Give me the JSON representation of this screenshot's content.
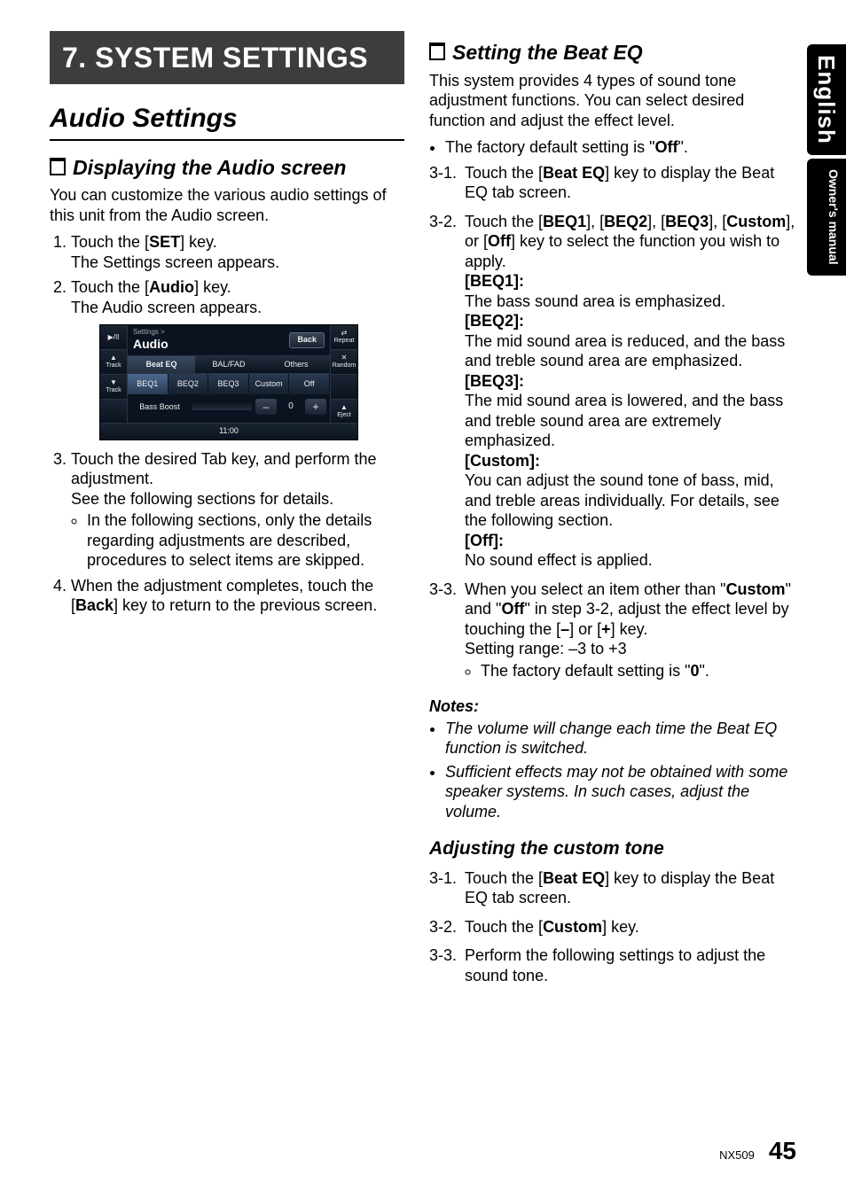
{
  "chapter": "7.  SYSTEM SETTINGS",
  "h2": "Audio Settings",
  "h3a": "Displaying the Audio screen",
  "p1": "You can customize the various audio settings of this unit from the Audio screen.",
  "left": {
    "s1a": "Touch the [",
    "s1b": "SET",
    "s1c": "] key.",
    "s1d": "The Settings screen appears.",
    "s2a": "Touch the [",
    "s2b": "Audio",
    "s2c": "] key.",
    "s2d": "The Audio screen appears.",
    "s3a": "Touch the desired Tab key, and perform the adjustment.",
    "s3b": "See the following sections for details.",
    "s3bullet": "In the following sections, only the details regarding adjustments are described, procedures to select items are skipped.",
    "s4a": "When the adjustment completes, touch the [",
    "s4b": "Back",
    "s4c": "] key to return to the previous screen."
  },
  "screenshot": {
    "crumb": "Settings >",
    "title": "Audio",
    "back": "Back",
    "tabs": [
      "Beat EQ",
      "BAL/FAD",
      "Others"
    ],
    "eq": [
      "BEQ1",
      "BEQ2",
      "BEQ3",
      "Custom",
      "Off"
    ],
    "bassboost": "Bass Boost",
    "value": "0",
    "time": "11:00",
    "side_left": [
      "▶/II",
      "▲",
      "Track",
      "▼",
      "Track",
      ""
    ],
    "side_right": [
      "⇄",
      "Repeat",
      "✕",
      "Random",
      "",
      "▲",
      "Eject"
    ]
  },
  "h3b": "Setting the Beat EQ",
  "right": {
    "intro": "This system provides 4 types of sound tone adjustment functions. You can select desired function and adjust the effect level.",
    "bul1_a": "The factory default setting is \"",
    "bul1_b": "Off",
    "bul1_c": "\".",
    "r31a": "Touch the [",
    "r31b": "Beat EQ",
    "r31c": "] key to display the Beat EQ tab screen.",
    "r32a": "Touch the [",
    "r32k": [
      "BEQ1",
      "BEQ2",
      "BEQ3",
      "Custom",
      "Off"
    ],
    "r32mid": "], [",
    "r32end": "] key to select the function you wish to apply.",
    "beq1h": "[BEQ1]:",
    "beq1": "The bass sound area is emphasized.",
    "beq2h": "[BEQ2]:",
    "beq2": "The mid sound area is reduced, and the bass and treble sound area are emphasized.",
    "beq3h": "[BEQ3]:",
    "beq3": "The mid sound area is lowered, and the bass and treble sound area are extremely emphasized.",
    "custh": "[Custom]:",
    "cust": "You can adjust the sound tone of bass, mid, and treble areas individually. For details, see the following section.",
    "offh": "[Off]:",
    "off": "No sound effect is applied.",
    "r33a": "When you select an item other than \"",
    "r33b": "Custom",
    "r33c": "\" and \"",
    "r33d": "Off",
    "r33e": "\" in step 3-2, adjust the effect level by touching the [",
    "r33f": "–",
    "r33g": "] or [",
    "r33h": "+",
    "r33i": "] key.",
    "r33range": "Setting range: –3 to +3",
    "r33bullet_a": "The factory default setting is \"",
    "r33bullet_b": "0",
    "r33bullet_c": "\".",
    "notesh": "Notes:",
    "note1": "The volume will change each time the Beat EQ function is switched.",
    "note2": "Sufficient effects may not be obtained with some speaker systems. In such cases, adjust the volume.",
    "h3c": "Adjusting the custom tone",
    "c31a": "Touch the [",
    "c31b": "Beat EQ",
    "c31c": "] key to display the Beat EQ tab screen.",
    "c32a": "Touch the [",
    "c32b": "Custom",
    "c32c": "] key.",
    "c33": "Perform the following settings to adjust the sound tone."
  },
  "tabs": {
    "lang": "English",
    "man": "Owner's manual"
  },
  "footer": {
    "model": "NX509",
    "page": "45"
  }
}
